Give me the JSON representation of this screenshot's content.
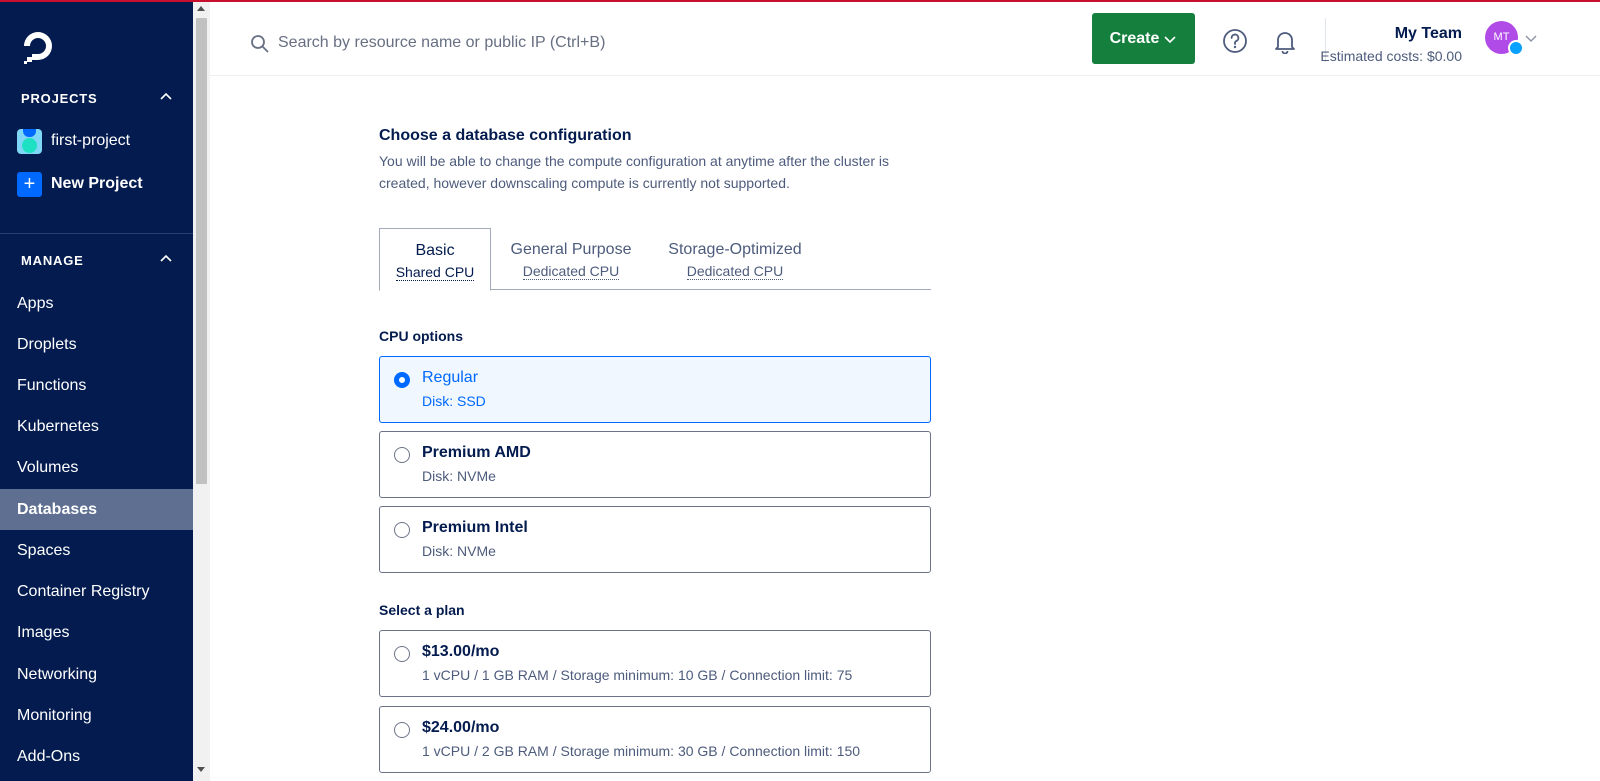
{
  "search": {
    "placeholder": "Search by resource name or public IP (Ctrl+B)"
  },
  "header": {
    "create_label": "Create",
    "team_name": "My Team",
    "estimated_costs": "Estimated costs: $0.00",
    "avatar_initials": "MT"
  },
  "sidebar": {
    "projects_heading": "PROJECTS",
    "projects": [
      {
        "label": "first-project"
      }
    ],
    "new_project_label": "New Project",
    "manage_heading": "MANAGE",
    "nav": [
      {
        "label": "Apps"
      },
      {
        "label": "Droplets"
      },
      {
        "label": "Functions"
      },
      {
        "label": "Kubernetes"
      },
      {
        "label": "Volumes"
      },
      {
        "label": "Databases",
        "active": true
      },
      {
        "label": "Spaces"
      },
      {
        "label": "Container Registry"
      },
      {
        "label": "Images"
      },
      {
        "label": "Networking"
      },
      {
        "label": "Monitoring"
      },
      {
        "label": "Add-Ons"
      }
    ]
  },
  "config": {
    "title": "Choose a database configuration",
    "description": "You will be able to change the compute configuration at anytime after the cluster is created, however downscaling compute is currently not supported.",
    "tabs": [
      {
        "label": "Basic",
        "sub": "Shared CPU",
        "active": true
      },
      {
        "label": "General Purpose",
        "sub": "Dedicated CPU"
      },
      {
        "label": "Storage-Optimized",
        "sub": "Dedicated CPU"
      }
    ],
    "cpu_options_label": "CPU options",
    "cpu_options": [
      {
        "title": "Regular",
        "sub": "Disk: SSD",
        "selected": true
      },
      {
        "title": "Premium AMD",
        "sub": "Disk: NVMe"
      },
      {
        "title": "Premium Intel",
        "sub": "Disk: NVMe"
      }
    ],
    "plan_label": "Select a plan",
    "plans": [
      {
        "price": "$13.00/mo",
        "specs": "1 vCPU / 1 GB RAM / Storage minimum: 10 GB / Connection limit: 75"
      },
      {
        "price": "$24.00/mo",
        "specs": "1 vCPU / 2 GB RAM / Storage minimum: 30 GB / Connection limit: 150"
      }
    ]
  },
  "colors": {
    "sidebar_bg": "#031b4e",
    "brand_blue": "#0069ff",
    "create_green": "#15803d",
    "active_nav": "#5f6f91"
  }
}
